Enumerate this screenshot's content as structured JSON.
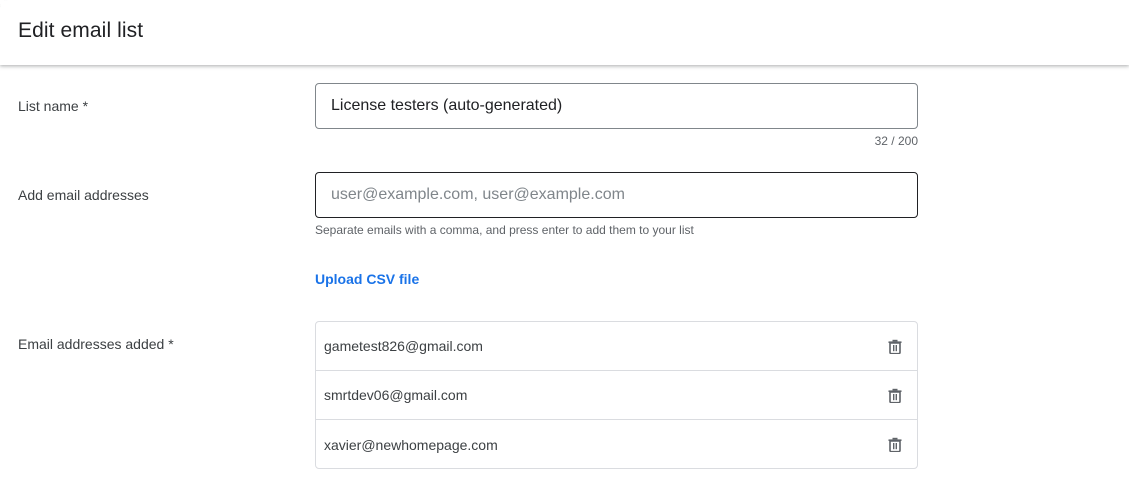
{
  "dialog": {
    "title": "Edit email list"
  },
  "form": {
    "list_name": {
      "label": "List name  *",
      "value": "License testers (auto-generated)",
      "counter": "32 / 200"
    },
    "add_emails": {
      "label": "Add email addresses",
      "placeholder": "user@example.com, user@example.com",
      "hint": "Separate emails with a comma, and press enter to add them to your list"
    },
    "upload_csv": {
      "label": "Upload CSV file"
    },
    "emails_added": {
      "label": "Email addresses added  *",
      "items": [
        {
          "email": "gametest826@gmail.com",
          "action_icon": "trash-icon"
        },
        {
          "email": "smrtdev06@gmail.com",
          "action_icon": "trash-icon"
        },
        {
          "email": "xavier@newhomepage.com",
          "action_icon": "trash-icon"
        }
      ]
    }
  },
  "colors": {
    "link": "#1a73e8",
    "border": "#80868b",
    "divider": "#dadce0",
    "text": "#202124",
    "muted": "#5f6368"
  }
}
